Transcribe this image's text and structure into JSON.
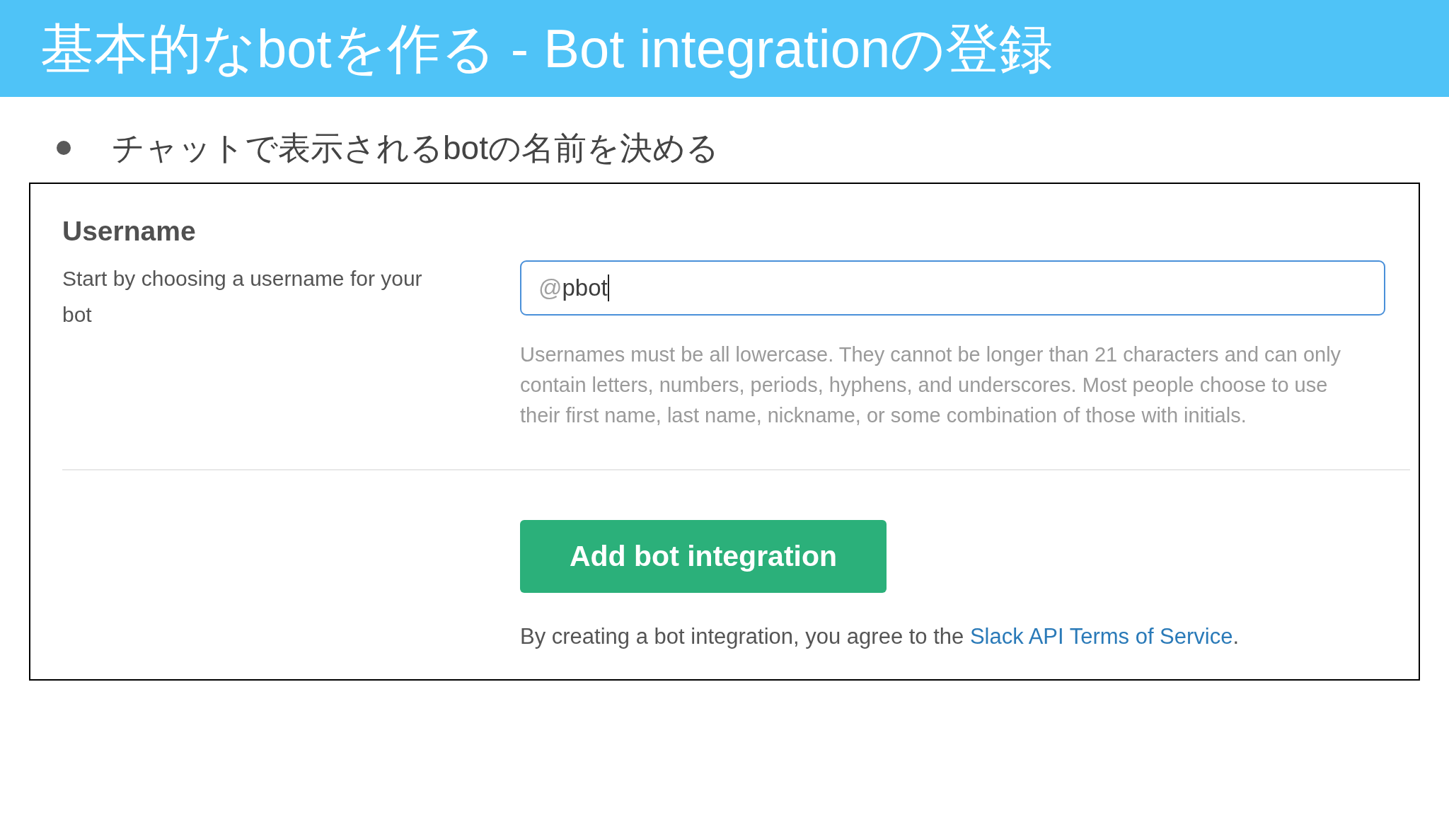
{
  "slide": {
    "title": "基本的なbotを作る - Bot integrationの登録"
  },
  "bullets": [
    "チャットで表示されるbotの名前を決める"
  ],
  "form": {
    "heading": "Username",
    "description": "Start by choosing a username for your bot",
    "input": {
      "prefix": "@",
      "value": "pbot",
      "focused": true
    },
    "help": "Usernames must be all lowercase. They cannot be longer than 21 characters and can only contain letters, numbers, periods, hyphens, and underscores. Most people choose to use their first name, last name, nickname, or some combination of those with initials.",
    "button": "Add bot integration",
    "terms": {
      "text": "By creating a bot integration, you agree to the ",
      "link": "Slack API Terms of Service",
      "suffix": "."
    }
  }
}
